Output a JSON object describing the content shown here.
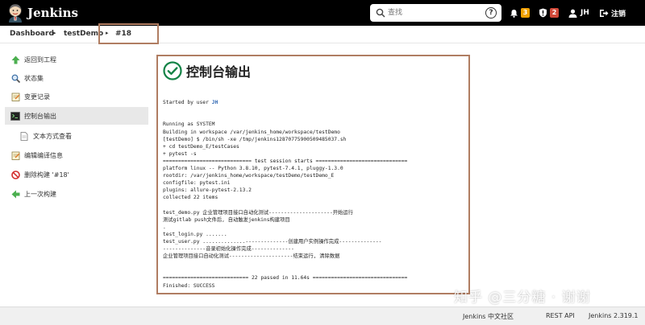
{
  "header": {
    "brand": "Jenkins",
    "search_placeholder": "查找",
    "notifications_count": "3",
    "security_count": "2",
    "user": "JH",
    "logout": "注销",
    "colors": {
      "bar": "#000000",
      "notify_badge": "#f0a100",
      "security_badge": "#d24939"
    }
  },
  "breadcrumb": {
    "items": [
      "Dashboard",
      "testDemo",
      "#18"
    ]
  },
  "sidebar": {
    "items": [
      {
        "label": "返回到工程",
        "icon": "arrow-up-icon"
      },
      {
        "label": "状态集",
        "icon": "magnifier-icon"
      },
      {
        "label": "变更记录",
        "icon": "notepad-icon"
      },
      {
        "label": "控制台输出",
        "icon": "terminal-icon"
      },
      {
        "label": "文本方式查看",
        "icon": "document-icon"
      },
      {
        "label": "编辑编译信息",
        "icon": "notepad-icon"
      },
      {
        "label": "删除构建 '#18'",
        "icon": "no-entry-icon"
      },
      {
        "label": "上一次构建",
        "icon": "arrow-left-icon"
      }
    ]
  },
  "main": {
    "title": "控制台输出",
    "console": {
      "started_prefix": "Started by user ",
      "started_user": "JH",
      "lines": [
        "Running as SYSTEM",
        "Building in workspace /var/jenkins_home/workspace/testDemo",
        "[testDemo] $ /bin/sh -xe /tmp/jenkins12870775900509485037.sh",
        "+ cd testDemo_E/testCases",
        "+ pytest -s",
        "============================= test session starts ==============================",
        "platform linux -- Python 3.8.10, pytest-7.4.1, pluggy-1.3.0",
        "rootdir: /var/jenkins_home/workspace/testDemo/testDemo_E",
        "configfile: pytest.ini",
        "plugins: allure-pytest-2.13.2",
        "collected 22 items",
        "",
        "test_demo.py 企业管理项目接口自动化测试---------------------开始运行",
        "测试gitlab push文件后, 自动触发jenkins构建项目",
        ".",
        "test_login.py .......",
        "test_user.py ..............--------------创建用户实例操作完成--------------",
        "--------------音录初始化操作完成--------------",
        "企业管理项目接口自动化测试---------------------结束运行, 清除数据",
        "",
        "",
        "============================ 22 passed in 11.64s ===============================",
        "Finished: SUCCESS"
      ]
    }
  },
  "watermark": "知乎 @三分糖 · 谢谢",
  "footer": {
    "community": "Jenkins 中文社区",
    "rest_api": "REST API",
    "version": "Jenkins 2.319.1"
  }
}
